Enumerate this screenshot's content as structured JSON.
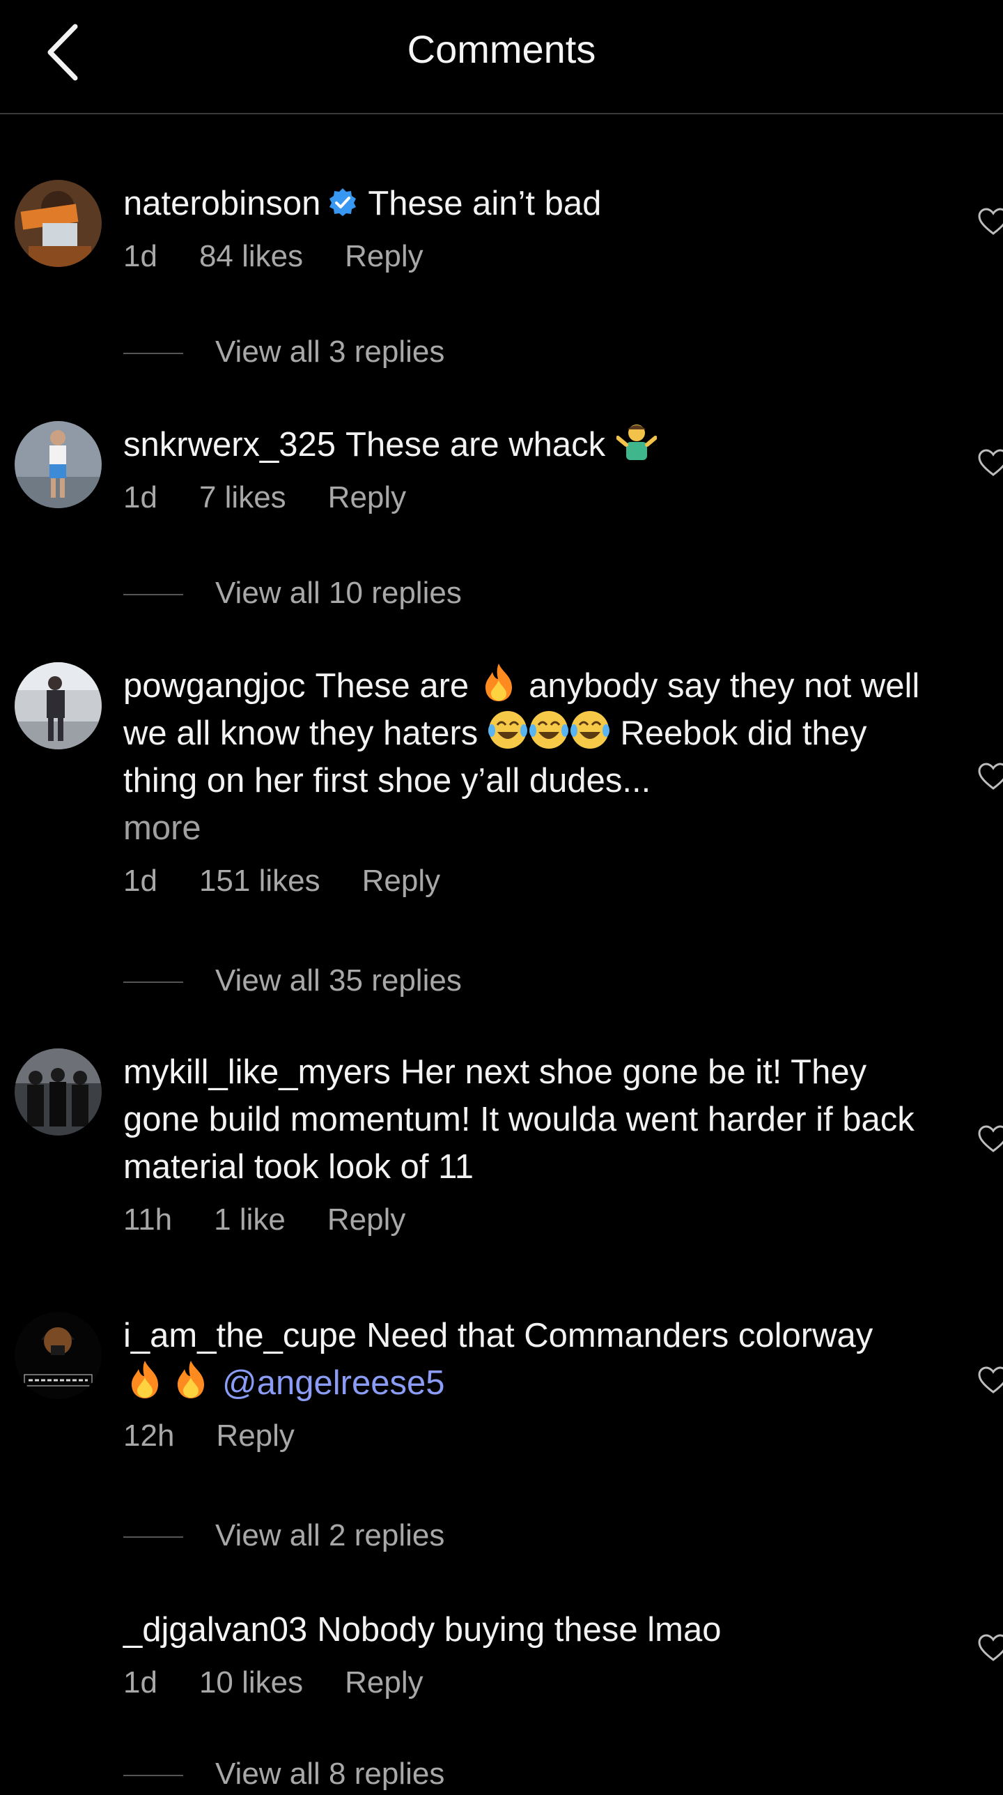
{
  "header": {
    "title": "Comments",
    "back_icon": "chevron-left-icon"
  },
  "colors": {
    "background": "#000000",
    "text": "#f2f2f2",
    "meta": "#a8a8a8",
    "mention": "#8a9cf5",
    "verified": "#3897f0"
  },
  "comments": [
    {
      "username": "naterobinson",
      "verified": true,
      "text": "These ain’t bad",
      "time": "1d",
      "likes": "84 likes",
      "reply": "Reply",
      "view_replies": "View all 3 replies"
    },
    {
      "username": "snkrwerx_325",
      "text": "These are whack",
      "emoji": "person-shrugging",
      "time": "1d",
      "likes": "7 likes",
      "reply": "Reply",
      "view_replies": "View all 10 replies"
    },
    {
      "username": "powgangjoc",
      "text_a": "These are",
      "text_b": "anybody say they not well we all know they haters",
      "text_c": "Reebok did they thing on her first shoe y’all dudes...",
      "more": "more",
      "time": "1d",
      "likes": "151 likes",
      "reply": "Reply",
      "view_replies": "View all 35 replies"
    },
    {
      "username": "mykill_like_myers",
      "text": "Her next shoe gone be it! They gone build momentum! It woulda went harder if back material took look of 11",
      "time": "11h",
      "likes": "1 like",
      "reply": "Reply"
    },
    {
      "username": "i_am_the_cupe",
      "text": "Need that Commanders colorway",
      "mention": "@angelreese5",
      "time": "12h",
      "reply": "Reply",
      "view_replies": "View all 2 replies"
    },
    {
      "username": "_djgalvan03",
      "text": "Nobody buying these lmao",
      "time": "1d",
      "likes": "10 likes",
      "reply": "Reply",
      "view_replies": "View all 8 replies"
    }
  ]
}
